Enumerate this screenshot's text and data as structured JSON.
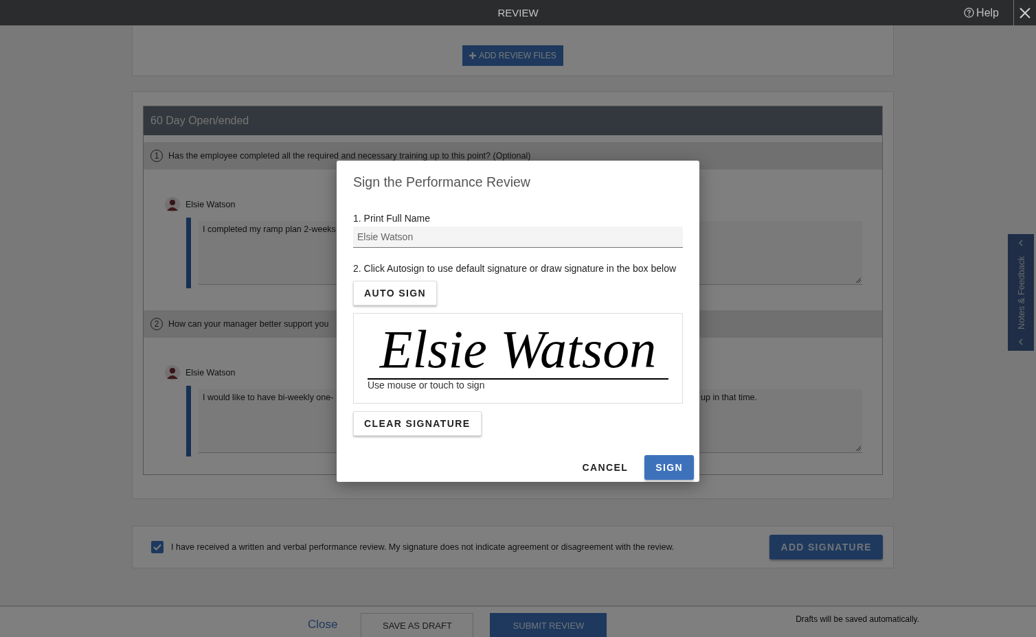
{
  "top_bar": {
    "title": "REVIEW",
    "help": "Help"
  },
  "files_card": {
    "button": "ADD REVIEW FILES"
  },
  "section": {
    "title": "60 Day Open/ended",
    "questions": [
      {
        "number": "1",
        "text": "Has the employee completed all the required and necessary training up to this point? (Optional)",
        "response": {
          "author": "Elsie Watson",
          "text": "I completed my ramp plan 2-weeks"
        }
      },
      {
        "number": "2",
        "text": "How can your manager better support you",
        "response": {
          "author": "Elsie Watson",
          "text": "I would like to have bi-weekly one-",
          "text_continued": "up in that time."
        }
      }
    ]
  },
  "acknowledgement": {
    "checked": true,
    "text": "I have received a written and verbal performance review. My signature does not indicate agreement or disagreement with the review.",
    "button": "ADD SIGNATURE"
  },
  "footer": {
    "close": "Close",
    "save_draft": "SAVE AS DRAFT",
    "submit": "SUBMIT REVIEW",
    "note": "Drafts will be saved automatically."
  },
  "notes_tab": {
    "label": "Notes & Feedback"
  },
  "dialog": {
    "title": "Sign the Performance Review",
    "step_1": "1. Print Full Name",
    "name_value": "Elsie Watson",
    "step_2": "2. Click Autosign to use default signature or draw signature in the box below",
    "auto_sign": "AUTO SIGN",
    "signature": "Elsie Watson",
    "signature_hint": "Use mouse or touch to sign",
    "clear_signature": "CLEAR SIGNATURE",
    "cancel": "CANCEL",
    "sign": "SIGN"
  }
}
